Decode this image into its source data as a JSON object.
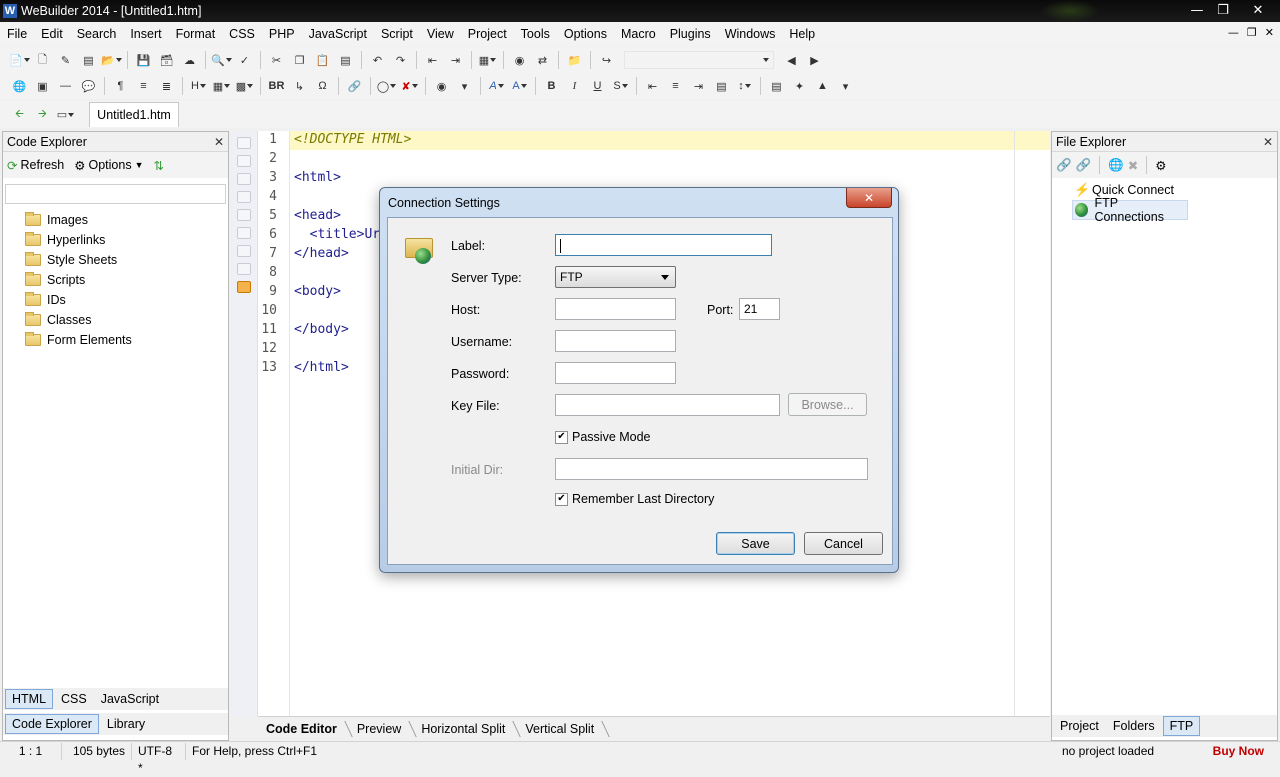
{
  "window": {
    "title": "WeBuilder 2014 - [Untitled1.htm]",
    "icon_letter": "W"
  },
  "menu": [
    "File",
    "Edit",
    "Search",
    "Insert",
    "Format",
    "CSS",
    "PHP",
    "JavaScript",
    "Script",
    "View",
    "Project",
    "Tools",
    "Options",
    "Macro",
    "Plugins",
    "Windows",
    "Help"
  ],
  "toolbar2": {
    "br_label": "BR",
    "bold": "B",
    "italic": "I",
    "underline": "U"
  },
  "doc_tab": "Untitled1.htm",
  "code_explorer": {
    "title": "Code Explorer",
    "refresh": "Refresh",
    "options": "Options",
    "items": [
      "Images",
      "Hyperlinks",
      "Style Sheets",
      "Scripts",
      "IDs",
      "Classes",
      "Form Elements"
    ],
    "lang_tabs": [
      "HTML",
      "CSS",
      "JavaScript"
    ],
    "bottom_tabs": [
      "Code Explorer",
      "Library"
    ]
  },
  "editor": {
    "line_numbers": [
      "1",
      "2",
      "3",
      "4",
      "5",
      "6",
      "7",
      "8",
      "9",
      "10",
      "11",
      "12",
      "13"
    ],
    "lines": [
      "<!DOCTYPE HTML>",
      "",
      "<html>",
      "",
      "<head>",
      "  <title>Ur",
      "</head>",
      "",
      "<body>",
      "",
      "</body>",
      "",
      "</html>"
    ],
    "tabs": [
      "Code Editor",
      "Preview",
      "Horizontal Split",
      "Vertical Split"
    ]
  },
  "file_explorer": {
    "title": "File Explorer",
    "items": [
      "Quick Connect",
      "FTP Connections"
    ],
    "bottom_tabs": [
      "Project",
      "Folders",
      "FTP"
    ]
  },
  "dialog": {
    "title": "Connection Settings",
    "label_label": "Label:",
    "label_value": "",
    "server_type_label": "Server Type:",
    "server_type_value": "FTP",
    "host_label": "Host:",
    "host_value": "",
    "port_label": "Port:",
    "port_value": "21",
    "username_label": "Username:",
    "username_value": "",
    "password_label": "Password:",
    "password_value": "",
    "keyfile_label": "Key File:",
    "keyfile_value": "",
    "browse": "Browse...",
    "passive_mode": "Passive Mode",
    "passive_checked": true,
    "initial_dir_label": "Initial Dir:",
    "initial_dir_value": "",
    "remember_dir": "Remember Last Directory",
    "remember_checked": true,
    "save": "Save",
    "cancel": "Cancel"
  },
  "status": {
    "position": "1 : 1",
    "size": "105 bytes",
    "encoding": "UTF-8 *",
    "help": "For Help, press Ctrl+F1",
    "project": "no project loaded",
    "buy": "Buy Now"
  }
}
